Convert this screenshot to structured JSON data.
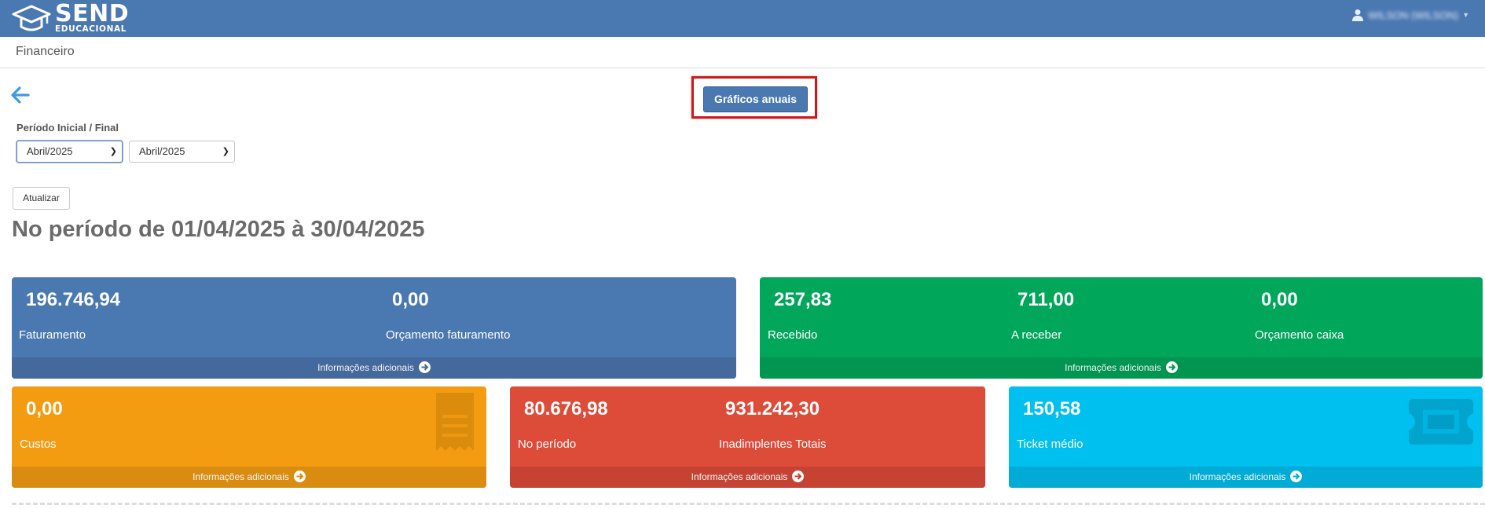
{
  "brand": {
    "line1": "SEND",
    "line2": "EDUCACIONAL"
  },
  "header": {
    "user_name": "WILSON (WILSON)"
  },
  "page": {
    "title": "Financeiro"
  },
  "toolbar": {
    "annual_charts_label": "Gráficos anuais",
    "update_label": "Atualizar"
  },
  "period": {
    "label": "Período Inicial / Final",
    "start_value": "Abril/2025",
    "end_value": "Abril/2025",
    "heading": "No período de 01/04/2025 à 30/04/2025"
  },
  "cards": {
    "faturamento": {
      "metrics": [
        {
          "value": "196.746,94",
          "label": "Faturamento"
        },
        {
          "value": "0,00",
          "label": "Orçamento faturamento"
        }
      ],
      "footer": "Informações adicionais"
    },
    "caixa": {
      "metrics": [
        {
          "value": "257,83",
          "label": "Recebido"
        },
        {
          "value": "711,00",
          "label": "A receber"
        },
        {
          "value": "0,00",
          "label": "Orçamento caixa"
        }
      ],
      "footer": "Informações adicionais"
    },
    "custos": {
      "metrics": [
        {
          "value": "0,00",
          "label": "Custos"
        }
      ],
      "footer": "Informações adicionais",
      "icon": "receipt-icon"
    },
    "inadimplentes": {
      "metrics": [
        {
          "value": "80.676,98",
          "label": "No período"
        },
        {
          "value": "931.242,30",
          "label": "Inadimplentes Totais"
        }
      ],
      "footer": "Informações adicionais"
    },
    "ticket": {
      "metrics": [
        {
          "value": "150,58",
          "label": "Ticket médio"
        }
      ],
      "footer": "Informações adicionais",
      "icon": "ticket-icon"
    }
  },
  "colors": {
    "header_blue": "#4a78b1",
    "green": "#00a65a",
    "orange": "#f39c12",
    "red": "#dd4b39",
    "aqua": "#00c0ef",
    "highlight": "#cc1a1a"
  }
}
